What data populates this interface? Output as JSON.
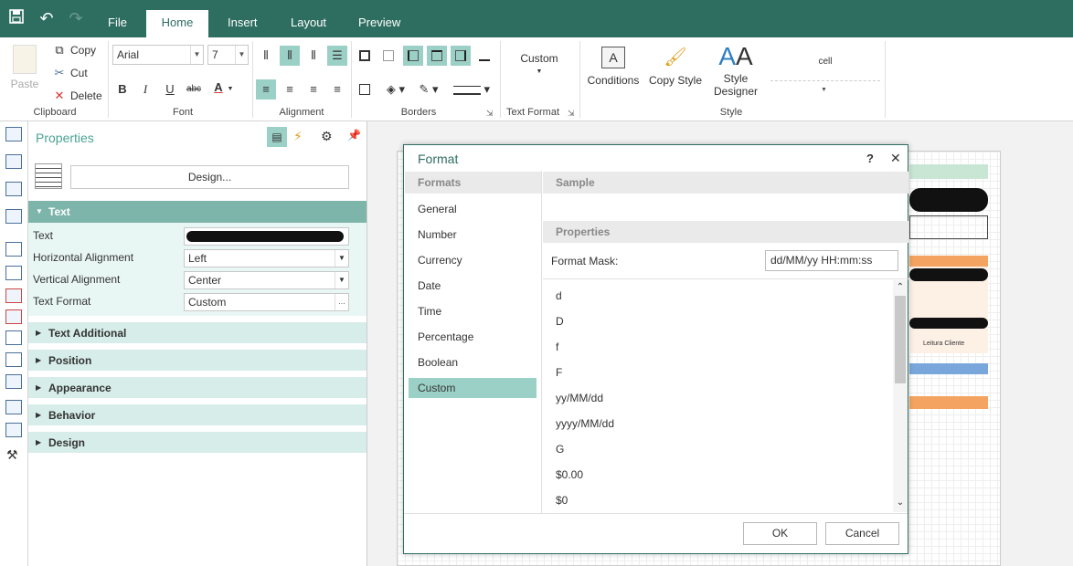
{
  "topbar": {
    "tabs": [
      "File",
      "Home",
      "Insert",
      "Layout",
      "Preview"
    ],
    "active_tab": "Home"
  },
  "ribbon": {
    "clipboard": {
      "paste": "Paste",
      "copy": "Copy",
      "cut": "Cut",
      "delete": "Delete",
      "label": "Clipboard"
    },
    "font": {
      "family": "Arial",
      "size": "7",
      "label": "Font"
    },
    "alignment": {
      "label": "Alignment"
    },
    "borders": {
      "label": "Borders"
    },
    "text_format": {
      "value": "Custom",
      "label": "Text Format"
    },
    "style": {
      "conditions": "Conditions",
      "copy_style": "Copy Style",
      "style_designer_1": "Style",
      "style_designer_2": "Designer",
      "cell": "cell",
      "label": "Style"
    }
  },
  "properties": {
    "title": "Properties",
    "design_button": "Design...",
    "text_section": "Text",
    "rows": [
      {
        "label": "Text",
        "value": ""
      },
      {
        "label": "Horizontal Alignment",
        "value": "Left"
      },
      {
        "label": "Vertical Alignment",
        "value": "Center"
      },
      {
        "label": "Text Format",
        "value": "Custom"
      }
    ],
    "sections": [
      "Text Additional",
      "Position",
      "Appearance",
      "Behavior",
      "Design"
    ]
  },
  "dialog": {
    "title": "Format",
    "help": "?",
    "close": "✕",
    "formats_header": "Formats",
    "sample_header": "Sample",
    "properties_header": "Properties",
    "format_mask_label": "Format Mask:",
    "format_mask_value": "dd/MM/yy HH:mm:ss",
    "formats": [
      "General",
      "Number",
      "Currency",
      "Date",
      "Time",
      "Percentage",
      "Boolean",
      "Custom"
    ],
    "selected_format": "Custom",
    "masks": [
      "d",
      "D",
      "f",
      "F",
      "yy/MM/dd",
      "yyyy/MM/dd",
      "G",
      "$0.00",
      "$0"
    ],
    "ok": "OK",
    "cancel": "Cancel"
  },
  "canvas": {
    "cell_label": "Leitura Cliente"
  }
}
